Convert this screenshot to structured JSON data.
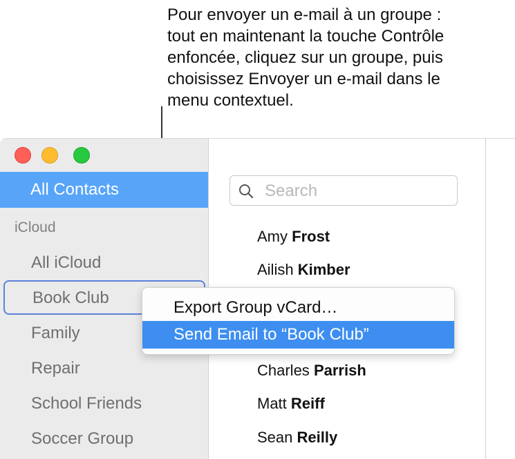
{
  "callout": {
    "lines": [
      "Pour envoyer un e-mail à un groupe :",
      "tout en maintenant la touche Contrôle",
      "enfoncée, cliquez sur un groupe, puis",
      "choisissez Envoyer un e-mail dans le",
      "menu contextuel."
    ]
  },
  "sidebar": {
    "all_contacts": "All Contacts",
    "section": "iCloud",
    "items": [
      {
        "label": "All iCloud"
      },
      {
        "label": "Book Club"
      },
      {
        "label": "Family"
      },
      {
        "label": "Repair"
      },
      {
        "label": "School Friends"
      },
      {
        "label": "Soccer Group"
      }
    ]
  },
  "search": {
    "placeholder": "Search",
    "icon": "search-icon"
  },
  "contacts": [
    {
      "first": "Amy",
      "last": "Frost"
    },
    {
      "first": "Ailish",
      "last": "Kimber"
    },
    {
      "first": "Charles",
      "last": "Parrish"
    },
    {
      "first": "Matt",
      "last": "Reiff"
    },
    {
      "first": "Sean",
      "last": "Reilly"
    }
  ],
  "context_menu": {
    "items": [
      {
        "label": "Export Group vCard…"
      },
      {
        "label": "Send Email to “Book Club”"
      }
    ]
  },
  "colors": {
    "selection": "#57a4f9",
    "menu_highlight": "#3d8ef0",
    "focus_ring": "#5b81da"
  }
}
